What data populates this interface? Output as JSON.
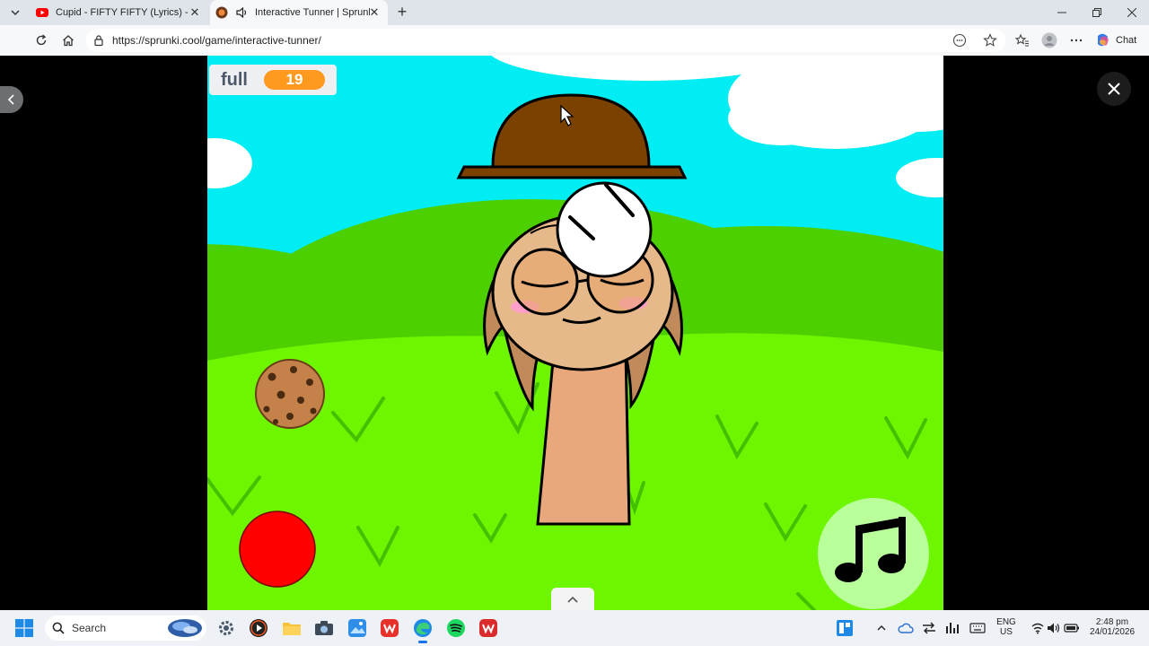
{
  "browser": {
    "tabs": [
      {
        "title": "Cupid - FIFTY FIFTY (Lyrics) - YouT",
        "icon": "youtube-icon"
      },
      {
        "title": "Interactive Tunner | Sprunki.c",
        "icon": "sprunki-icon",
        "active": true,
        "audio": "speaker-icon"
      }
    ],
    "url": "https://sprunki.cool/game/interactive-tunner/",
    "chat_label": "Chat"
  },
  "game": {
    "score_label": "full",
    "score_value": "19"
  },
  "taskbar": {
    "search_placeholder": "Search",
    "language_line1": "ENG",
    "language_line2": "US",
    "time": "2:48 pm",
    "date": "24/01/2026"
  },
  "colors": {
    "sky": "#00eef3",
    "grass": "#6ef600",
    "hill": "#4dd000",
    "hat": "#7a4101",
    "skin": "#e6b98a",
    "score_pill": "#ff9a1f",
    "record_button": "#ff0000",
    "music_button": "#b9ff9a"
  }
}
